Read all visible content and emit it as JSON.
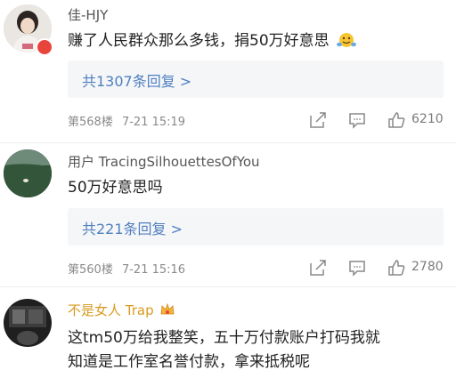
{
  "comments": [
    {
      "username": "佳-HJY",
      "text": "赚了人民群众那么多钱，捐50万好意思",
      "replies_label": "共1307条回复 >",
      "floor": "第568楼",
      "time": "7-21 15:19",
      "likes": "6210"
    },
    {
      "username": "用户 TracingSilhouettesOfYou",
      "text": "50万好意思吗",
      "replies_label": "共221条回复 >",
      "floor": "第560楼",
      "time": "7-21 15:16",
      "likes": "2780"
    },
    {
      "username": "不是女人 Trap",
      "text_line1": "这tm50万给我整笑，五十万付款账户打码我就",
      "text_line2": "知道是工作室名誉付款，拿来抵税呢"
    }
  ],
  "icons": [
    "emoji-icon",
    "share-icon",
    "comment-icon",
    "like-icon",
    "crown-badge-icon"
  ],
  "colors": {
    "link": "#4f7fc0",
    "gold_username": "#d99a1e",
    "badge_red": "#e9443c"
  }
}
